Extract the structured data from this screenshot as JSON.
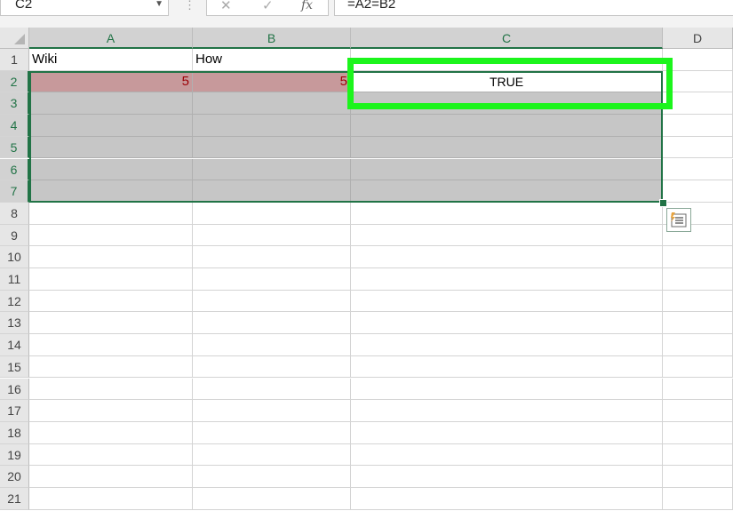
{
  "name_box": {
    "value": "C2"
  },
  "formula_bar": {
    "cancel_glyph": "✕",
    "enter_glyph": "✓",
    "fx_label": "fx",
    "formula": "=A2=B2"
  },
  "columns": [
    "A",
    "B",
    "C",
    "D"
  ],
  "rows": [
    "1",
    "2",
    "3",
    "4",
    "5",
    "6",
    "7",
    "8",
    "9",
    "10",
    "11",
    "12",
    "13",
    "14",
    "15",
    "16",
    "17",
    "18",
    "19",
    "20",
    "21"
  ],
  "cells": {
    "A1": "Wiki",
    "B1": "How",
    "A2": "5",
    "B2": "5",
    "C2": "TRUE"
  },
  "colors": {
    "selection_border": "#217346",
    "highlight_box": "#1cf51c",
    "bad_fill": "#c7999b",
    "bad_text": "#9c0006"
  },
  "icons": {
    "quick_analysis": "quick-analysis-icon"
  }
}
